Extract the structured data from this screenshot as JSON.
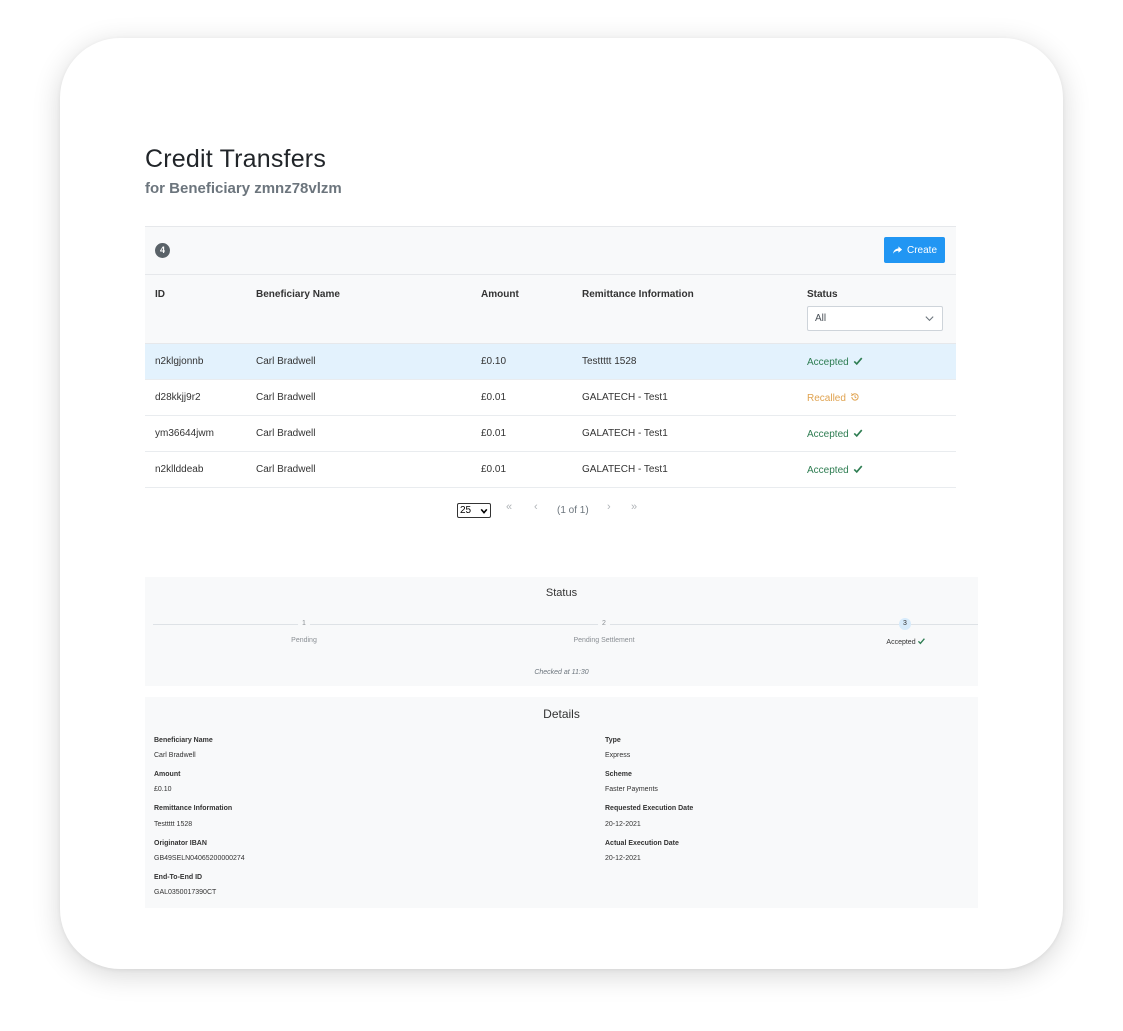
{
  "page": {
    "title": "Credit Transfers",
    "subtitle": "for Beneficiary zmnz78vlzm"
  },
  "toolbar": {
    "count": "4",
    "create_label": "Create"
  },
  "table": {
    "headers": {
      "id": "ID",
      "beneficiary_name": "Beneficiary Name",
      "amount": "Amount",
      "remittance": "Remittance Information",
      "status": "Status"
    },
    "status_filter": "All",
    "rows": [
      {
        "id": "n2klgjonnb",
        "name": "Carl Bradwell",
        "amount": "£0.10",
        "remittance": "Testtttt 1528",
        "status": "Accepted",
        "status_icon": "check-icon",
        "selected": true
      },
      {
        "id": "d28kkjj9r2",
        "name": "Carl Bradwell",
        "amount": "£0.01",
        "remittance": "GALATECH - Test1",
        "status": "Recalled",
        "status_icon": "history-icon",
        "selected": false
      },
      {
        "id": "ym36644jwm",
        "name": "Carl Bradwell",
        "amount": "£0.01",
        "remittance": "GALATECH - Test1",
        "status": "Accepted",
        "status_icon": "check-icon",
        "selected": false
      },
      {
        "id": "n2klldde­ab",
        "name": "Carl Bradwell",
        "amount": "£0.01",
        "remittance": "GALATECH - Test1",
        "status": "Accepted",
        "status_icon": "check-icon",
        "selected": false
      }
    ]
  },
  "paginator": {
    "rows_per_page": "25",
    "page_report": "(1 of 1)",
    "first": "«",
    "prev": "‹",
    "next": "›",
    "last": "»"
  },
  "status_panel": {
    "title": "Status",
    "steps": [
      {
        "number": "1",
        "label": "Pending"
      },
      {
        "number": "2",
        "label": "Pending Settlement"
      },
      {
        "number": "3",
        "label": "Accepted"
      }
    ],
    "checked_at": "Checked at 11:30"
  },
  "details": {
    "title": "Details",
    "left": [
      {
        "label": "Beneficiary Name",
        "value": "Carl Bradwell"
      },
      {
        "label": "Amount",
        "value": "£0.10"
      },
      {
        "label": "Remittance Information",
        "value": "Testtttt 1528"
      },
      {
        "label": "Originator IBAN",
        "value": "GB49SELN04065200000274"
      },
      {
        "label": "End-To-End ID",
        "value": "GAL0350017390CT"
      }
    ],
    "right": [
      {
        "label": "Type",
        "value": "Express"
      },
      {
        "label": "Scheme",
        "value": "Faster Payments"
      },
      {
        "label": "Requested Execution Date",
        "value": "20-12-2021"
      },
      {
        "label": "Actual Execution Date",
        "value": "20-12-2021"
      }
    ]
  },
  "colors": {
    "accent": "#2196f3",
    "accepted": "#2e7d52",
    "recalled": "#e0a350",
    "selected_row": "#e3f2fd"
  }
}
